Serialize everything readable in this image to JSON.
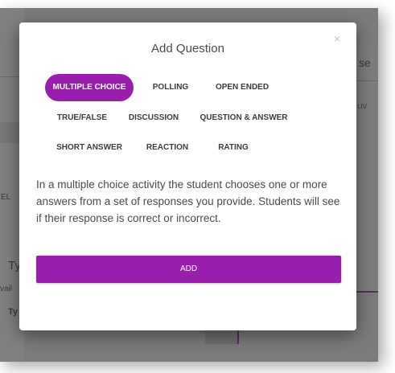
{
  "background": {
    "left_labels": [
      "EL",
      "Ty",
      "vail",
      "Ty"
    ],
    "right_labels": [
      "se",
      "LIV"
    ]
  },
  "dialog": {
    "title": "Add Question",
    "close_icon": "close-icon",
    "close_glyph": "×",
    "question_types": [
      {
        "label": "MULTIPLE CHOICE",
        "selected": true
      },
      {
        "label": "POLLING",
        "selected": false
      },
      {
        "label": "OPEN ENDED",
        "selected": false
      },
      {
        "label": "TRUE/FALSE",
        "selected": false
      },
      {
        "label": "DISCUSSION",
        "selected": false
      },
      {
        "label": "QUESTION & ANSWER",
        "selected": false
      },
      {
        "label": "SHORT ANSWER",
        "selected": false
      },
      {
        "label": "REACTION",
        "selected": false
      },
      {
        "label": "RATING",
        "selected": false
      }
    ],
    "description": "In a multiple choice activity the student chooses one or more answers from a set of responses you provide. Students will see if their response is correct or incorrect.",
    "add_label": "ADD"
  },
  "colors": {
    "accent": "#9a1eae",
    "overlay": "#7b7b7b"
  }
}
